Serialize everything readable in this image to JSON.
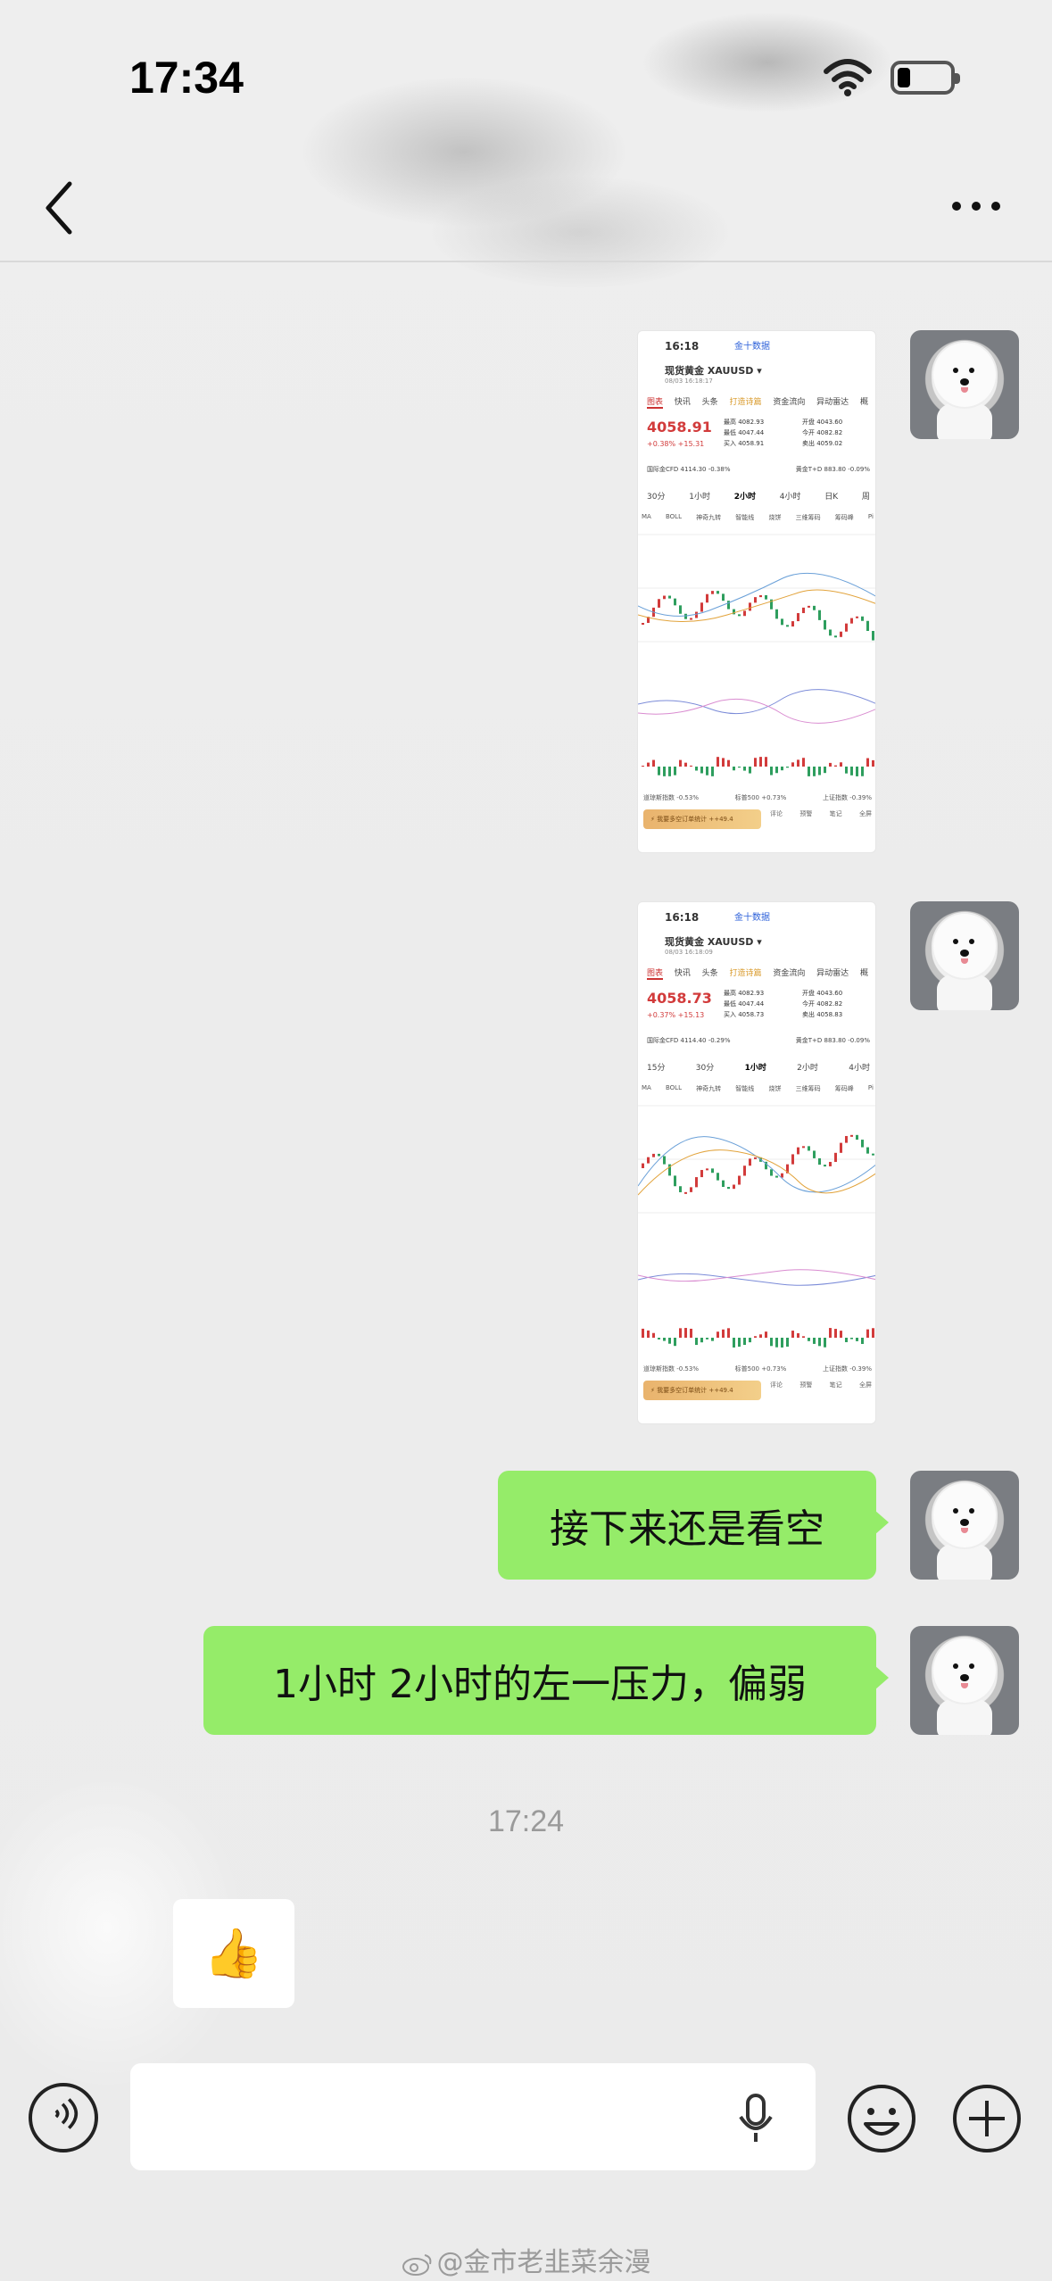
{
  "status_bar": {
    "time": "17:34",
    "wifi_icon": "wifi-icon",
    "battery_icon": "battery-icon"
  },
  "nav": {
    "back_icon": "chevron-left-icon",
    "more_icon": "more-dots-icon"
  },
  "screenshots": [
    {
      "time": "16:18",
      "brand": "金十数据",
      "title": "现货黄金 XAUUSD ▾",
      "subtitle": "08/03 16:18:17",
      "tabs": [
        "图表",
        "快讯",
        "头条",
        "打造诗篇",
        "资金流向",
        "异动雷达",
        "概"
      ],
      "price": "4058.91",
      "change": "+0.38%  +15.31",
      "kv_left": [
        "最高 4082.93",
        "最低 4047.44",
        "买入 4058.91"
      ],
      "kv_right": [
        "开盘 4043.60",
        "今开 4082.82",
        "卖出 4059.02"
      ],
      "cfd": [
        "国际金CFD 4114.30 -0.38%",
        "黄金T+D 883.80 -0.09%"
      ],
      "periods": [
        "30分",
        "1小时",
        "2小时",
        "4小时",
        "日K",
        "周"
      ],
      "active_period": "2小时",
      "indicators": [
        "MA",
        "BOLL",
        "神奇九转",
        "智能线",
        "烧饼",
        "三维筹码",
        "筹码峰",
        "Pi"
      ],
      "footer": [
        "道琼斯指数 -0.53%",
        "标普500 +0.73%",
        "上证指数 -0.39%"
      ],
      "cta": "⚡ 我要多空订单统计 ++49.4",
      "icons": [
        "评论",
        "预警",
        "笔记",
        "全屏"
      ]
    },
    {
      "time": "16:18",
      "brand": "金十数据",
      "title": "现货黄金 XAUUSD ▾",
      "subtitle": "08/03 16:18:09",
      "tabs": [
        "图表",
        "快讯",
        "头条",
        "打造诗篇",
        "资金流向",
        "异动雷达",
        "概"
      ],
      "price": "4058.73",
      "change": "+0.37%  +15.13",
      "kv_left": [
        "最高 4082.93",
        "最低 4047.44",
        "买入 4058.73"
      ],
      "kv_right": [
        "开盘 4043.60",
        "今开 4082.82",
        "卖出 4058.83"
      ],
      "cfd": [
        "国际金CFD 4114.40 -0.29%",
        "黄金T+D 883.80 -0.09%"
      ],
      "periods": [
        "15分",
        "30分",
        "1小时",
        "2小时",
        "4小时"
      ],
      "active_period": "1小时",
      "indicators": [
        "MA",
        "BOLL",
        "神奇九转",
        "智能线",
        "烧饼",
        "三维筹码",
        "筹码峰",
        "Pi"
      ],
      "footer": [
        "道琼斯指数 -0.53%",
        "标普500 +0.73%",
        "上证指数 -0.39%"
      ],
      "cta": "⚡ 我要多空订单统计 ++49.4",
      "icons": [
        "评论",
        "预警",
        "笔记",
        "全屏"
      ]
    }
  ],
  "messages": {
    "text1": "接下来还是看空",
    "text2": "1小时 2小时的左一压力，偏弱",
    "timestamp": "17:24",
    "reply_emoji": "👍"
  },
  "input_bar": {
    "placeholder": "",
    "voice_icon": "voice-icon",
    "mic_icon": "microphone-icon",
    "emoji_icon": "emoji-icon",
    "plus_icon": "plus-icon"
  },
  "watermark": "@金市老韭菜余漫",
  "colors": {
    "bubble_green": "#95ec69",
    "background": "#ededed",
    "price_red": "#d23b3b"
  }
}
